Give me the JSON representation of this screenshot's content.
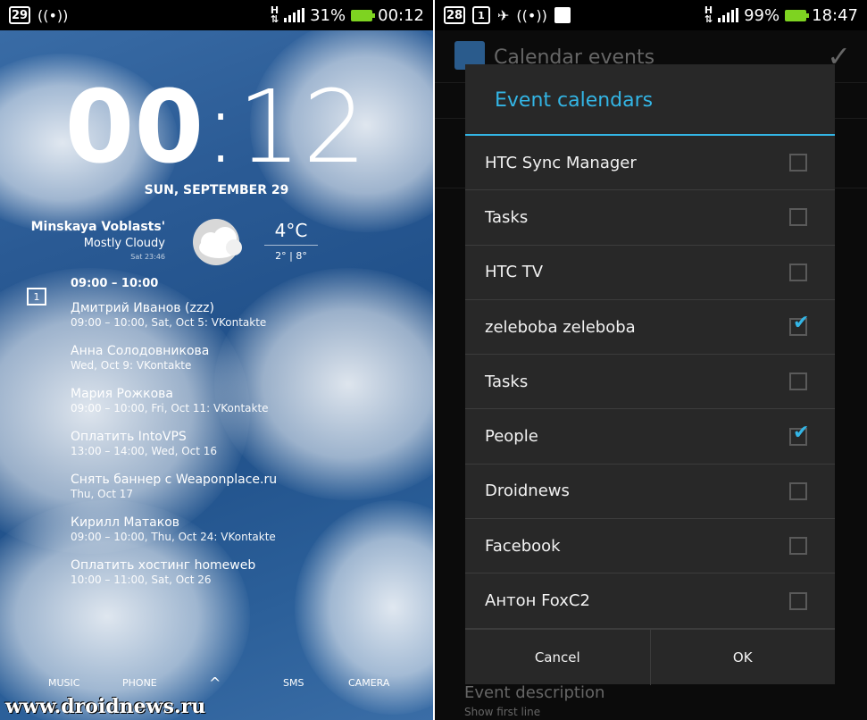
{
  "left": {
    "status": {
      "date_icon": "29",
      "battery": "31%",
      "time": "00:12",
      "net": "H"
    },
    "clock": {
      "hours": "00",
      "minutes": "12"
    },
    "date": "SUN, SEPTEMBER 29",
    "weather": {
      "location": "Minskaya Voblasts'",
      "condition": "Mostly Cloudy",
      "updated": "Sat 23:46",
      "temp": "4°C",
      "range": "2° | 8°",
      "icon": "cloudy-icon"
    },
    "calendar_icon_text": "1",
    "events_header": "09:00 – 10:00",
    "events": [
      {
        "title": "Дмитрий Иванов (zzz)",
        "sub": "09:00 – 10:00, Sat, Oct 5: VKontakte"
      },
      {
        "title": "Анна Солодовникова",
        "sub": "Wed, Oct 9: VKontakte"
      },
      {
        "title": "Мария Рожкова",
        "sub": "09:00 – 10:00, Fri, Oct 11: VKontakte"
      },
      {
        "title": "Оплатить IntoVPS",
        "sub": "13:00 – 14:00, Wed, Oct 16"
      },
      {
        "title": "Снять баннер с Weaponplace.ru",
        "sub": "Thu, Oct 17"
      },
      {
        "title": "Кирилл Матаков",
        "sub": "09:00 – 10:00, Thu, Oct 24: VKontakte"
      },
      {
        "title": "Оплатить хостинг homeweb",
        "sub": "10:00 – 11:00, Sat, Oct 26"
      }
    ],
    "bottom": {
      "music": "MUSIC",
      "phone": "PHONE",
      "up": "^",
      "sms": "SMS",
      "camera": "CAMERA"
    },
    "watermark": "www.droidnews.ru"
  },
  "right": {
    "status": {
      "date_icon": "28",
      "small_icon": "1",
      "battery": "99%",
      "time": "18:47",
      "net": "H"
    },
    "appbar_title": "Calendar events",
    "background_label": "Event description",
    "background_sub": "Show first line",
    "dialog": {
      "title": "Event calendars",
      "items": [
        {
          "label": "HTC Sync Manager",
          "checked": false
        },
        {
          "label": "Tasks",
          "checked": false
        },
        {
          "label": "HTC TV",
          "checked": false
        },
        {
          "label": "zeleboba zeleboba",
          "checked": true
        },
        {
          "label": "Tasks",
          "checked": false
        },
        {
          "label": "People",
          "checked": true
        },
        {
          "label": "Droidnews",
          "checked": false
        },
        {
          "label": "Facebook",
          "checked": false
        },
        {
          "label": "Антон FoxC2",
          "checked": false
        }
      ],
      "cancel": "Cancel",
      "ok": "OK"
    }
  },
  "colors": {
    "accent": "#33b5e5",
    "battery": "#7ed321",
    "dialog_bg": "#282828"
  }
}
